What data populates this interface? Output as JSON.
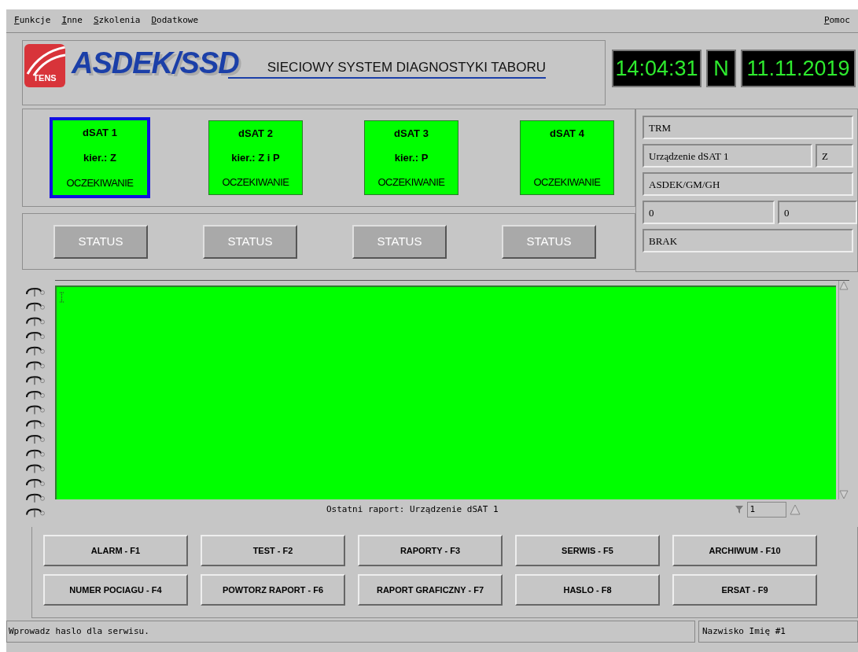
{
  "menu": [
    "Funkcje",
    "Inne",
    "Szkolenia",
    "Dodatkowe"
  ],
  "help_menu": "Pomoc",
  "logo": {
    "badge": "TENS",
    "wordmark": "ASDEK/SSD"
  },
  "title": "SIECIOWY SYSTEM DIAGNOSTYKI TABORU",
  "clock": {
    "time": "14:04:31",
    "mode": "N",
    "date": "11.11.2019"
  },
  "devices": [
    {
      "name": "dSAT 1",
      "direction": "kier.: Z",
      "state": "OCZEKIWANIE",
      "selected": true,
      "status_button": "STATUS"
    },
    {
      "name": "dSAT 2",
      "direction": "kier.: Z i P",
      "state": "OCZEKIWANIE",
      "selected": false,
      "status_button": "STATUS"
    },
    {
      "name": "dSAT 3",
      "direction": "kier.: P",
      "state": "OCZEKIWANIE",
      "selected": false,
      "status_button": "STATUS"
    },
    {
      "name": "dSAT 4",
      "state": "OCZEKIWANIE",
      "selected": false,
      "status_button": "STATUS"
    }
  ],
  "info_fields": [
    [
      "TRM"
    ],
    [
      "Urządzenie dSAT 1",
      "Z"
    ],
    [
      "ASDEK/GM/GH"
    ],
    [
      "0",
      "0"
    ],
    [
      "BRAK"
    ]
  ],
  "report": {
    "caption": "Ostatni raport: Urządzenie dSAT 1",
    "page": "1"
  },
  "function_buttons": [
    [
      "ALARM - F1",
      "TEST - F2",
      "RAPORTY - F3",
      "SERWIS - F5",
      "ARCHIWUM - F10"
    ],
    [
      "NUMER POCIAGU - F4",
      "POWTORZ RAPORT - F6",
      "RAPORT GRAFICZNY - F7",
      "HASLO - F8",
      "ERSAT - F9"
    ]
  ],
  "status_bar": {
    "message": "Wprowadz haslo dla serwisu.",
    "user": "Nazwisko Imię #1"
  }
}
